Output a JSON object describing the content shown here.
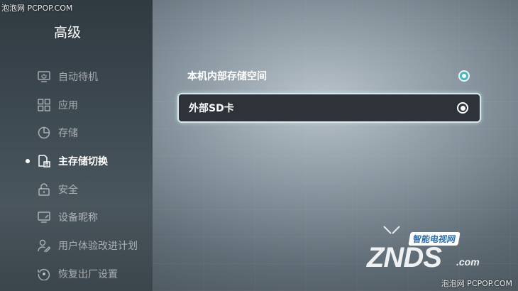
{
  "watermark": {
    "top": "泡泡网 PCPOP.COM",
    "bottom": "泡泡网 PCPOP.COM"
  },
  "sidebar": {
    "title": "高级",
    "items": [
      {
        "label": "自动待机",
        "icon": "standby-icon",
        "active": false
      },
      {
        "label": "应用",
        "icon": "apps-grid-icon",
        "active": false
      },
      {
        "label": "存储",
        "icon": "storage-pie-icon",
        "active": false
      },
      {
        "label": "主存储切换",
        "icon": "storage-switch-icon",
        "active": true
      },
      {
        "label": "安全",
        "icon": "lock-icon",
        "active": false
      },
      {
        "label": "设备昵称",
        "icon": "device-name-icon",
        "active": false
      },
      {
        "label": "用户体验改进计划",
        "icon": "user-edit-icon",
        "active": false
      },
      {
        "label": "恢复出厂设置",
        "icon": "factory-reset-icon",
        "active": false
      }
    ]
  },
  "options": [
    {
      "label": "本机内部存储空间",
      "selected": true,
      "focused": false
    },
    {
      "label": "外部SD卡",
      "selected": false,
      "focused": true
    }
  ],
  "logo": {
    "tag": "智能电视网",
    "word": "ZNDS",
    "suffix": ".com"
  },
  "colors": {
    "accent": "#49b6c2",
    "sidebar_bg": "#3a454c",
    "focus_border": "#d9e6ea"
  }
}
